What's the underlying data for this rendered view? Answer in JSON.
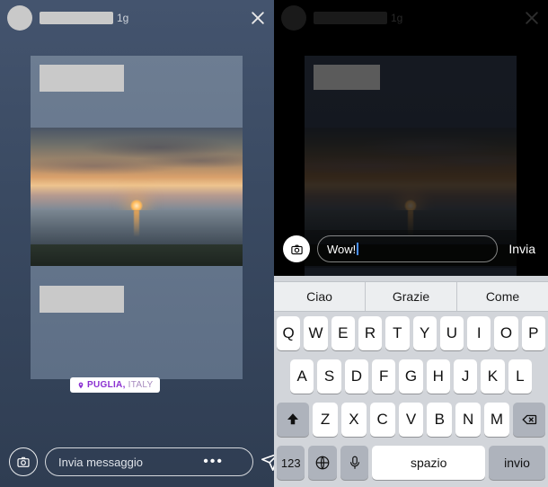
{
  "left": {
    "time": "1g",
    "location": {
      "main": "PUGLIA,",
      "sub": "ITALY"
    },
    "input_placeholder": "Invia messaggio"
  },
  "right": {
    "time": "1g",
    "reply_value": "Wow!",
    "send_label": "Invia"
  },
  "keyboard": {
    "suggestions": [
      "Ciao",
      "Grazie",
      "Come"
    ],
    "row1": [
      "Q",
      "W",
      "E",
      "R",
      "T",
      "Y",
      "U",
      "I",
      "O",
      "P"
    ],
    "row2": [
      "A",
      "S",
      "D",
      "F",
      "G",
      "H",
      "J",
      "K",
      "L"
    ],
    "row3": [
      "Z",
      "X",
      "C",
      "V",
      "B",
      "N",
      "M"
    ],
    "numkey": "123",
    "space": "spazio",
    "return": "invio"
  }
}
